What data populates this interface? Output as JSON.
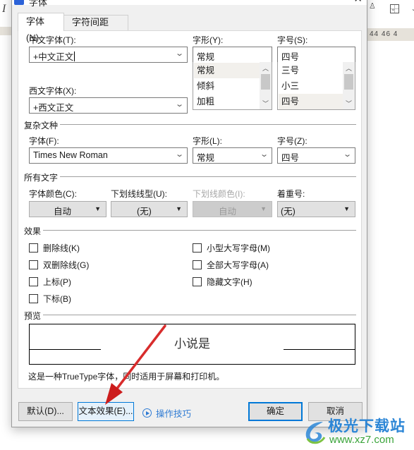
{
  "background": {
    "ruler_numbers": "44  46  4"
  },
  "dialog": {
    "title": "字体",
    "tabs": [
      {
        "label": "字体(N)",
        "active": true
      },
      {
        "label": "字符间距(R)",
        "active": false
      }
    ],
    "chinese_font": {
      "label": "中文字体(T):",
      "value": "+中文正文"
    },
    "western_font": {
      "label": "西文字体(X):",
      "value": "+西文正文"
    },
    "style": {
      "label": "字形(Y):",
      "value": "常规",
      "options": [
        "常规",
        "倾斜",
        "加粗"
      ],
      "selected": "常规"
    },
    "size": {
      "label": "字号(S):",
      "value": "四号",
      "options": [
        "三号",
        "小三",
        "四号"
      ],
      "selected": "四号"
    },
    "complex_script": {
      "section_title": "复杂文种",
      "font": {
        "label": "字体(F):",
        "value": "Times New Roman"
      },
      "style": {
        "label": "字形(L):",
        "value": "常规"
      },
      "size": {
        "label": "字号(Z):",
        "value": "四号"
      }
    },
    "all_text": {
      "section_title": "所有文字",
      "font_color": {
        "label": "字体颜色(C):",
        "value": "自动"
      },
      "underline_style": {
        "label": "下划线线型(U):",
        "value": "(无)"
      },
      "underline_color": {
        "label": "下划线颜色(I):",
        "value": "自动",
        "disabled": true
      },
      "emphasis_mark": {
        "label": "着重号:",
        "value": "(无)"
      }
    },
    "effects": {
      "section_title": "效果",
      "left": [
        {
          "label": "删除线(K)",
          "checked": false
        },
        {
          "label": "双删除线(G)",
          "checked": false
        },
        {
          "label": "上标(P)",
          "checked": false
        },
        {
          "label": "下标(B)",
          "checked": false
        }
      ],
      "right": [
        {
          "label": "小型大写字母(M)",
          "checked": false
        },
        {
          "label": "全部大写字母(A)",
          "checked": false
        },
        {
          "label": "隐藏文字(H)",
          "checked": false
        }
      ]
    },
    "preview": {
      "section_title": "预览",
      "sample_text": "小说是",
      "description": "这是一种TrueType字体，同时适用于屏幕和打印机。"
    },
    "buttons": {
      "default": "默认(D)...",
      "text_effects": "文本效果(E)...",
      "tips": "操作技巧",
      "ok": "确定",
      "cancel": "取消"
    }
  },
  "annotation": {
    "arrow_color": "#d42020"
  },
  "watermark": {
    "title": "极光下载站",
    "url": "www.xz7.com"
  }
}
